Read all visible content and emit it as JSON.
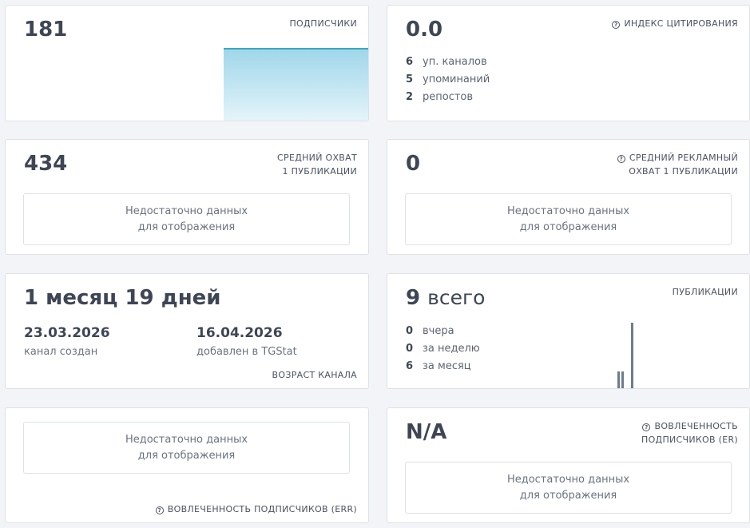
{
  "subscribers": {
    "value": "181",
    "label": "ПОДПИСЧИКИ"
  },
  "citation": {
    "value": "0.0",
    "label": "ИНДЕКС ЦИТИРОВАНИЯ",
    "stats": [
      {
        "num": "6",
        "text": "уп. каналов"
      },
      {
        "num": "5",
        "text": "упоминаний"
      },
      {
        "num": "2",
        "text": "репостов"
      }
    ]
  },
  "avg_reach": {
    "value": "434",
    "label_line1": "СРЕДНИЙ ОХВАТ",
    "label_line2": "1 ПУБЛИКАЦИИ",
    "nodata_line1": "Недостаточно данных",
    "nodata_line2": "для отображения"
  },
  "ad_reach": {
    "value": "0",
    "label_line1": "СРЕДНИЙ РЕКЛАМНЫЙ",
    "label_line2": "ОХВАТ 1 ПУБЛИКАЦИИ",
    "nodata_line1": "Недостаточно данных",
    "nodata_line2": "для отображения"
  },
  "age": {
    "value": "1 месяц 19 дней",
    "created_date": "23.03.2026",
    "created_caption": "канал создан",
    "added_date": "16.04.2026",
    "added_caption": "добавлен в TGStat",
    "label": "ВОЗРАСТ КАНАЛА"
  },
  "posts": {
    "value": "9",
    "unit": "всего",
    "label": "ПУБЛИКАЦИИ",
    "stats": [
      {
        "num": "0",
        "text": "вчера"
      },
      {
        "num": "0",
        "text": "за неделю"
      },
      {
        "num": "6",
        "text": "за месяц"
      }
    ]
  },
  "err": {
    "nodata_line1": "Недостаточно данных",
    "nodata_line2": "для отображения",
    "label": "ВОВЛЕЧЕННОСТЬ ПОДПИСЧИКОВ (ERR)"
  },
  "er": {
    "value": "N/A",
    "label_line1": "ВОВЛЕЧЕННОСТЬ",
    "label_line2": "ПОДПИСЧИКОВ (ER)",
    "nodata_line1": "Недостаточно данных",
    "nodata_line2": "для отображения"
  },
  "colors": {
    "accent_fill": "#a9dced",
    "accent_line": "#3aa7c4",
    "bar": "#6f7c8c"
  }
}
